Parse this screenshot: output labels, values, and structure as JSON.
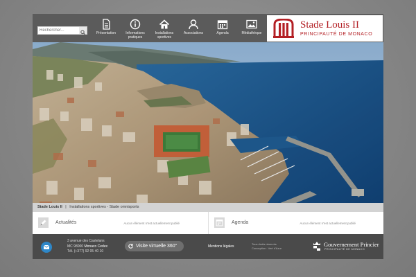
{
  "search": {
    "placeholder": "Rechercher..."
  },
  "nav": [
    {
      "label": "Présentation",
      "icon": "document-icon"
    },
    {
      "label": "Informations pratiques",
      "icon": "info-icon"
    },
    {
      "label": "Installations sportives",
      "icon": "home-icon"
    },
    {
      "label": "Associations",
      "icon": "people-icon"
    },
    {
      "label": "Agenda",
      "icon": "calendar-icon"
    },
    {
      "label": "Médiathèque",
      "icon": "image-icon"
    }
  ],
  "brand": {
    "title": "Stade Louis II",
    "subtitle": "PRINCIPAUTÉ DE MONACO"
  },
  "breadcrumb": {
    "home": "Stade Louis II",
    "separator": "|",
    "path": "Installations sportives - Stade omnisports"
  },
  "widgets": [
    {
      "title": "Actualités",
      "text": "Aucun élément n'est actuellement publié",
      "icon": "pencil-icon"
    },
    {
      "title": "Agenda",
      "text": "Aucun élément n'est actuellement publié",
      "icon": "calendar-icon"
    }
  ],
  "footer": {
    "address_line1": "3 avenue des Castelans",
    "address_postcode": "MC 98000",
    "address_city": "Monaco Cedex",
    "phone": "Tél. (+377) 92 05 40 10",
    "virtual_tour": "Visite virtuelle 360°",
    "mentions": "Mentions légales",
    "rights_line1": "Tous droits réservés",
    "rights_line2": "Conception : Vert d'Azur",
    "gov_title": "Gouvernement Princier",
    "gov_subtitle": "PRINCIPAUTÉ DE MONACO"
  },
  "colors": {
    "brand_red": "#b31f24",
    "mail_blue": "#2e87c8",
    "header_gray": "#5b5b5b"
  }
}
